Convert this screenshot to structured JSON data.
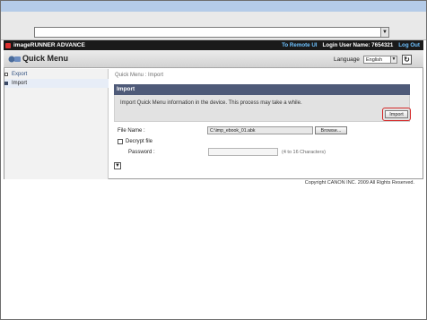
{
  "top_bar": {
    "brand": "imageRUNNER ADVANCE",
    "remote_ui_link": "To Remote UI",
    "login_user": "Login User Name: 7654321",
    "logout_link": "Log Out"
  },
  "header": {
    "title": "Quick Menu",
    "language_label": "Language",
    "language_value": "English",
    "refresh_symbol": "↻"
  },
  "sidebar": {
    "items": [
      {
        "label": "Export"
      },
      {
        "label": "Import"
      }
    ]
  },
  "main": {
    "breadcrumb": "Quick Menu : Import",
    "section_title": "Import",
    "description": "Import Quick Menu information in the device. This process may take a while.",
    "import_button": "Import",
    "file_label": "File Name :",
    "file_value": "C:\\imp_ebook_01.abk",
    "browse_button": "Browse...",
    "decrypt_label": "Decrypt file",
    "password_label": "Password :",
    "password_hint": "(4 to 16 Characters)",
    "collapse_symbol": "▼"
  },
  "footer": {
    "copyright": "Copyright CANON INC. 2009 All Rights Reserved."
  },
  "colors": {
    "top_bar_bg": "#1a1a1a",
    "link_blue": "#6ec1ff",
    "section_header_bg": "#4e5a78",
    "highlight_red": "#d42a2a"
  }
}
